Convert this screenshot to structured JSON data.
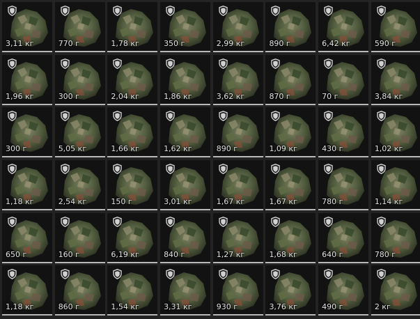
{
  "inventory": {
    "columns": 8,
    "item_icon": "camo-rock-item",
    "badge_icon": "shield-icon",
    "rows": [
      [
        "3,11 кг",
        "770 г",
        "1,78 кг",
        "350 г",
        "2,99 кг",
        "890 г",
        "6,42 кг",
        "590 г"
      ],
      [
        "1,96 кг",
        "300 г",
        "2,04 кг",
        "1,86 кг",
        "3,62 кг",
        "870 г",
        "70 г",
        "3,84 кг"
      ],
      [
        "300 г",
        "5,05 кг",
        "1,66 кг",
        "1,62 кг",
        "890 г",
        "1,09 кг",
        "430 г",
        "1,02 кг"
      ],
      [
        "1,18 кг",
        "2,54 кг",
        "150 г",
        "3,01 кг",
        "1,67 кг",
        "1,67 кг",
        "780 г",
        "1,14 кг"
      ],
      [
        "650 г",
        "160 г",
        "6,19 кг",
        "840 г",
        "1,27 кг",
        "1,68 кг",
        "640 г",
        "780 г"
      ],
      [
        "1,18 кг",
        "860 г",
        "1,54 кг",
        "3,31 кг",
        "930 г",
        "3,76 кг",
        "490 г",
        "2 кг"
      ]
    ]
  }
}
